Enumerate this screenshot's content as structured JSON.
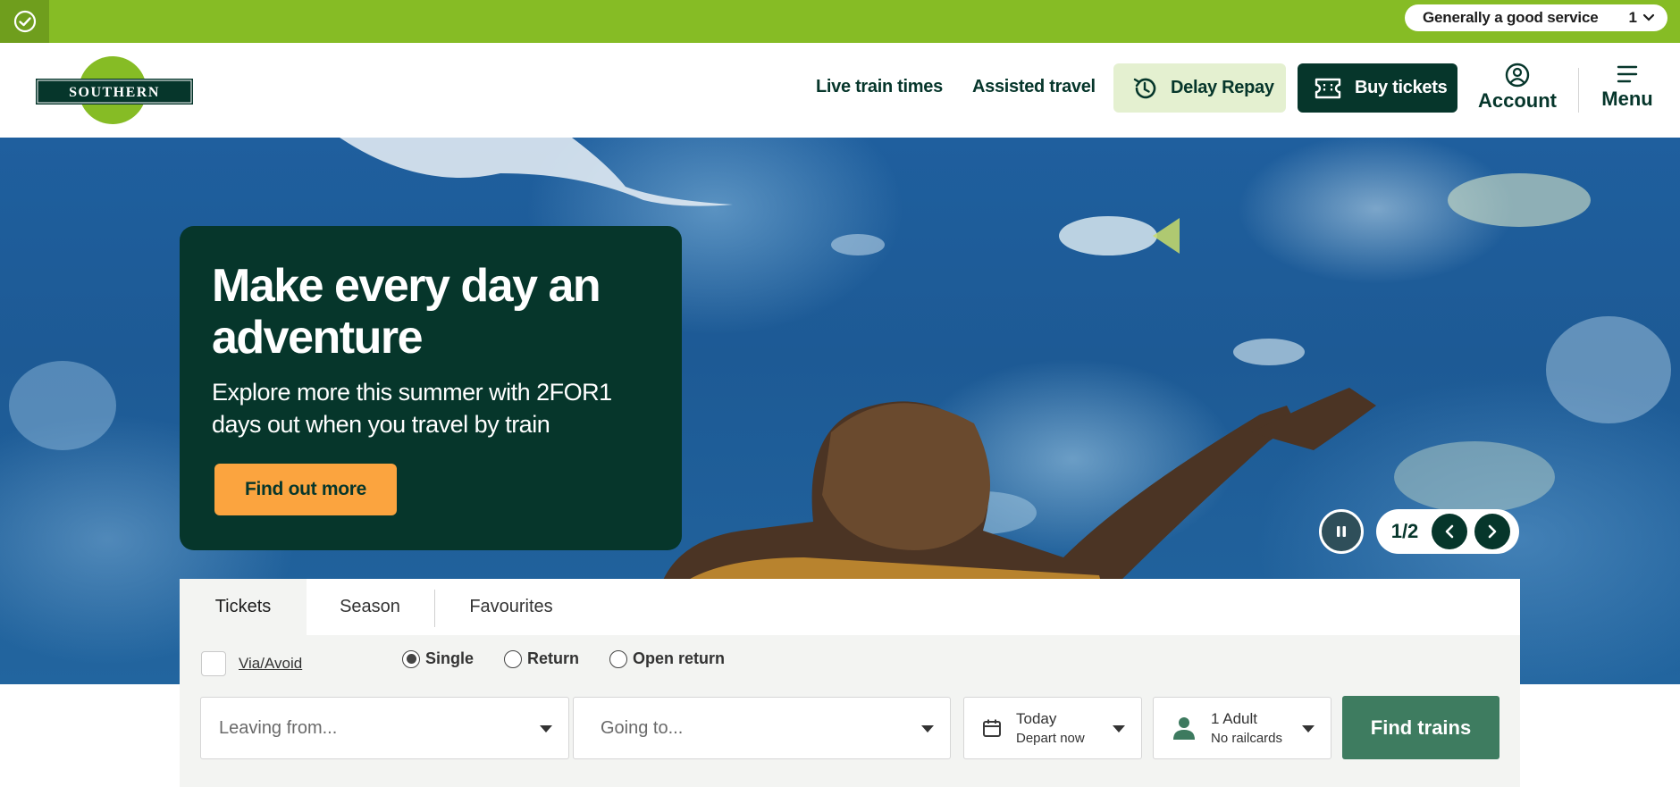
{
  "status_bar": {
    "icon": "check-circle-icon",
    "service_text": "Generally a good service",
    "count": "1"
  },
  "header": {
    "logo_text": "SOUTHERN",
    "nav": {
      "live_train_times": "Live train times",
      "assisted_travel": "Assisted travel",
      "delay_repay": "Delay Repay",
      "buy_tickets": "Buy tickets",
      "account": "Account",
      "menu": "Menu"
    }
  },
  "hero": {
    "title": "Make every day an adventure",
    "subtitle": "Explore more this summer with 2FOR1 days out when you travel by train",
    "cta": "Find out more",
    "slide_counter": "1/2"
  },
  "booking": {
    "tabs": [
      "Tickets",
      "Season",
      "Favourites"
    ],
    "active_tab": "Tickets",
    "via_avoid": "Via/Avoid",
    "journey_types": [
      "Single",
      "Return",
      "Open return"
    ],
    "selected_journey_type": "Single",
    "leaving_placeholder": "Leaving from...",
    "going_placeholder": "Going to...",
    "date_line1": "Today",
    "date_line2": "Depart now",
    "passengers_line1": "1 Adult",
    "passengers_line2": "No railcards",
    "find_button": "Find trains"
  },
  "colors": {
    "brand_dark": "#06362b",
    "brand_green": "#86bc25",
    "accent_orange": "#fba43f",
    "find_green": "#3e7c60"
  }
}
